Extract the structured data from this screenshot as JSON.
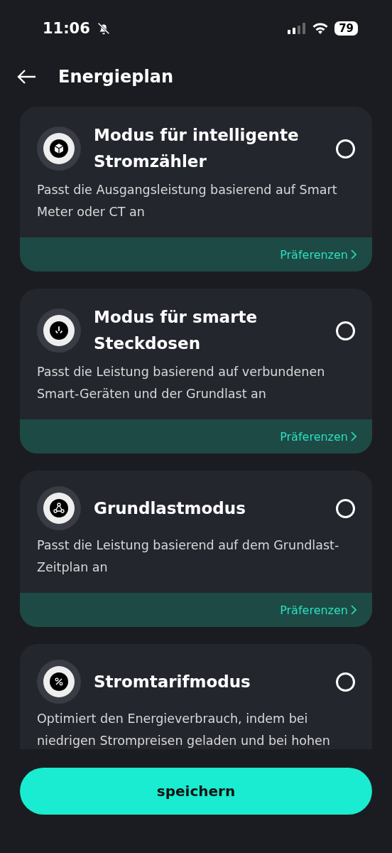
{
  "status_bar": {
    "time": "11:06",
    "battery": "79"
  },
  "header": {
    "title": "Energieplan"
  },
  "modes": [
    {
      "title": "Modus für intelligente Stromzähler",
      "description": "Passt die Ausgangsleistung basierend auf Smart Meter oder CT an",
      "selected": false,
      "preferences": "Präferenzen"
    },
    {
      "title": "Modus für smarte Steckdosen",
      "description": "Passt die Leistung basierend auf verbundenen Smart-Geräten und der Grundlast an",
      "selected": false,
      "preferences": "Präferenzen"
    },
    {
      "title": "Grundlastmodus",
      "description": "Passt die Leistung basierend auf dem Grundlast-Zeitplan an",
      "selected": false,
      "preferences": "Präferenzen"
    },
    {
      "title": "Stromtarifmodus",
      "description": "Optimiert den Energieverbrauch, indem bei niedrigen Strompreisen geladen und bei hohen",
      "selected": false
    }
  ],
  "save_button": "speichern"
}
